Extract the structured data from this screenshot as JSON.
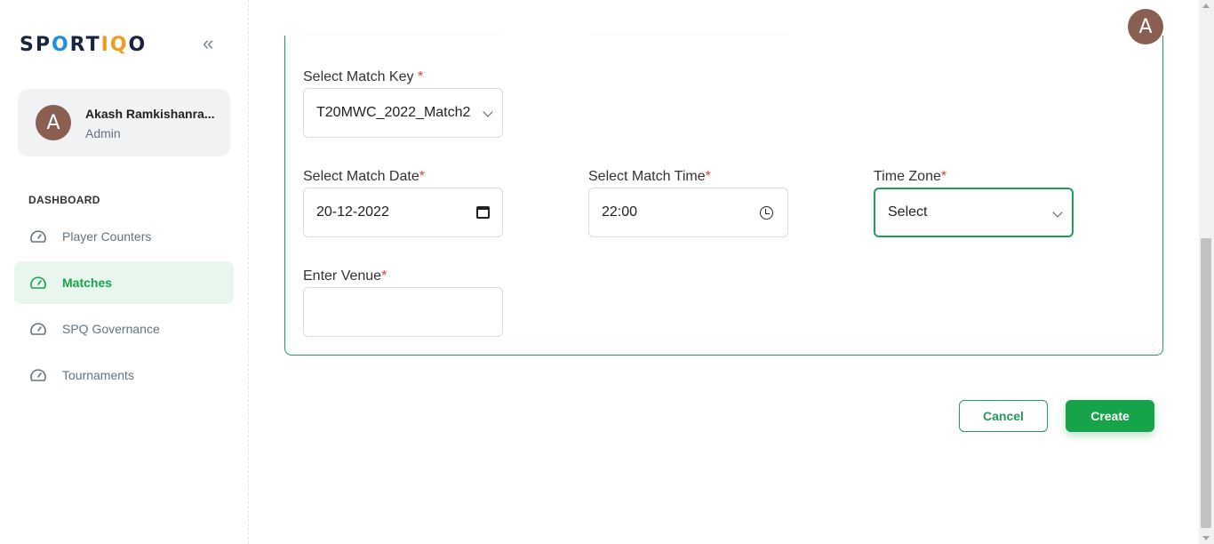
{
  "app": {
    "logo_prefix": "SP",
    "logo_o": "O",
    "logo_rt": "RT",
    "logo_iq": "IQ",
    "logo_suffix": "O",
    "collapse_glyph": "«"
  },
  "user": {
    "initial": "A",
    "name": "Akash Ramkishanra...",
    "role": "Admin"
  },
  "sidebar": {
    "section": "DASHBOARD",
    "items": [
      {
        "label": "Player Counters",
        "icon": "speedometer-icon",
        "active": false
      },
      {
        "label": "Matches",
        "icon": "speedometer-icon",
        "active": true
      },
      {
        "label": "SPQ Governance",
        "icon": "speedometer-icon",
        "active": false
      },
      {
        "label": "Tournaments",
        "icon": "speedometer-icon",
        "active": false
      }
    ]
  },
  "form": {
    "match_key": {
      "label": "Select Match Key ",
      "required": "*",
      "value": "T20MWC_2022_Match2"
    },
    "match_date": {
      "label": "Select Match Date",
      "required": "*",
      "value": "20-12-2022"
    },
    "match_time": {
      "label": "Select Match Time",
      "required": "*",
      "value": "22:00"
    },
    "time_zone": {
      "label": "Time Zone",
      "required": "*",
      "value": "Select"
    },
    "venue": {
      "label": "Enter Venue",
      "required": "*",
      "value": ""
    }
  },
  "actions": {
    "cancel": "Cancel",
    "create": "Create"
  },
  "colors": {
    "accent": "#16a34a",
    "active_bg": "#e9f6ee",
    "required": "#e53935",
    "avatar": "#8b5e52"
  }
}
